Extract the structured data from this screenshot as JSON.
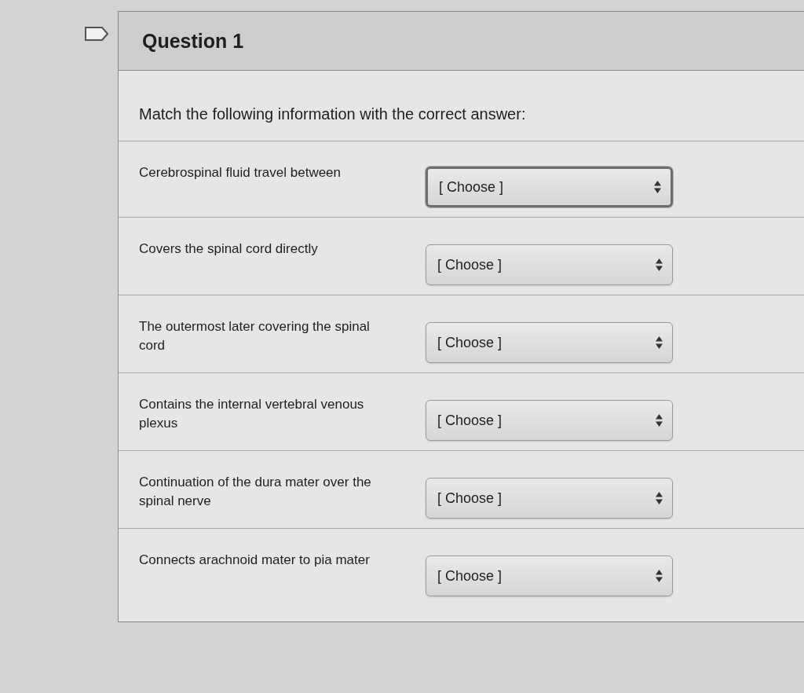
{
  "question": {
    "title": "Question 1",
    "instruction": "Match the following information with the correct answer:"
  },
  "items": [
    {
      "prompt": "Cerebrospinal fluid travel between",
      "answer": {
        "value": "[ Choose ]",
        "focused": true
      }
    },
    {
      "prompt": "Covers the spinal cord directly",
      "answer": {
        "value": "[ Choose ]",
        "focused": false
      }
    },
    {
      "prompt": "The outermost later covering the spinal cord",
      "answer": {
        "value": "[ Choose ]",
        "focused": false
      }
    },
    {
      "prompt": "Contains the internal vertebral venous plexus",
      "answer": {
        "value": "[ Choose ]",
        "focused": false
      }
    },
    {
      "prompt": "Continuation of the dura mater over the spinal nerve",
      "answer": {
        "value": "[ Choose ]",
        "focused": false
      }
    },
    {
      "prompt": "Connects arachnoid mater to pia mater",
      "answer": {
        "value": "[ Choose ]",
        "focused": false
      }
    }
  ]
}
